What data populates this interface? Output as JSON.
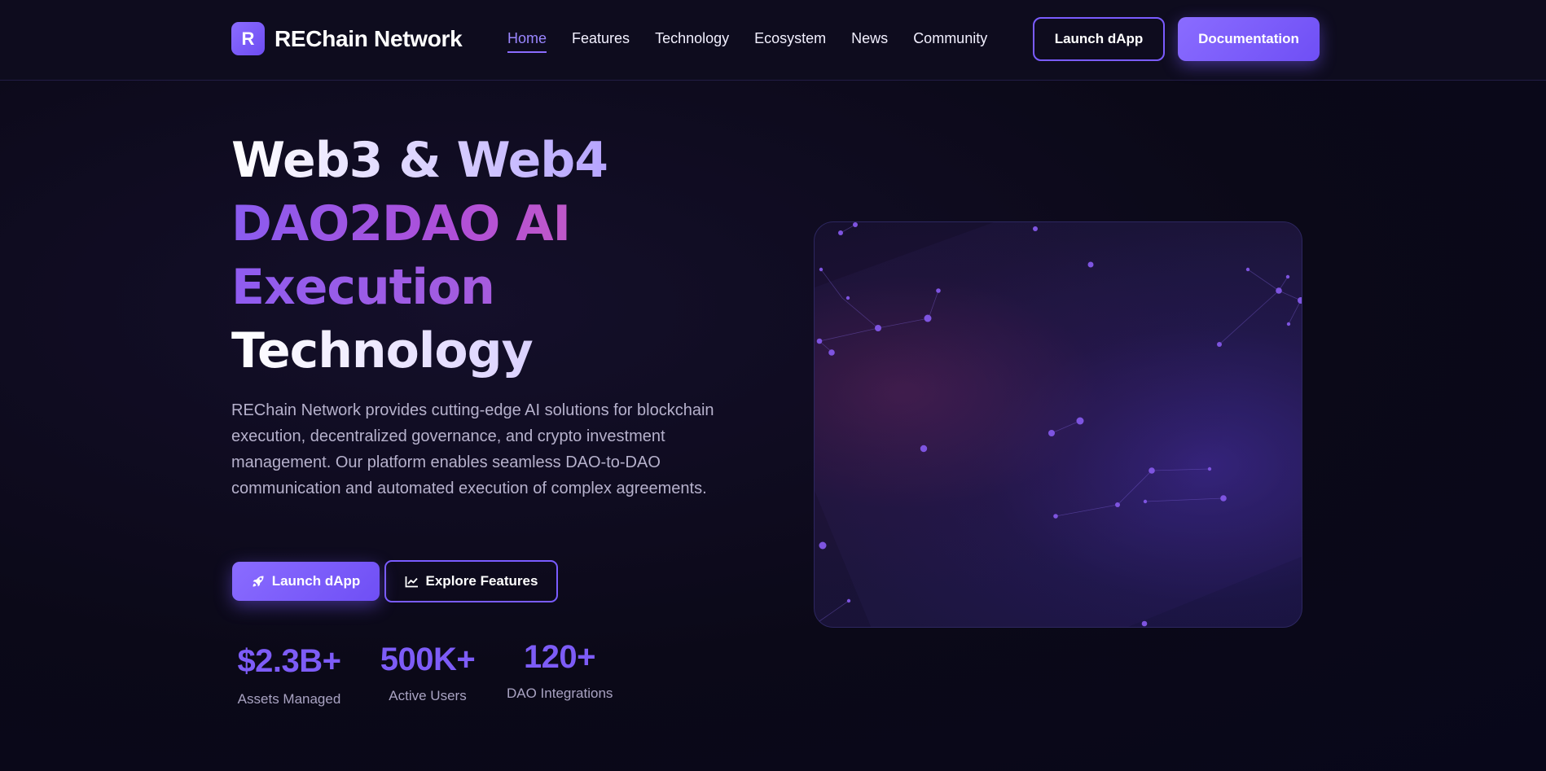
{
  "header": {
    "logo_letter": "R",
    "brand": "REChain Network",
    "nav": [
      {
        "label": "Home",
        "active": true
      },
      {
        "label": "Features",
        "active": false
      },
      {
        "label": "Technology",
        "active": false
      },
      {
        "label": "Ecosystem",
        "active": false
      },
      {
        "label": "News",
        "active": false
      },
      {
        "label": "Community",
        "active": false
      }
    ],
    "launch_label": "Launch dApp",
    "docs_label": "Documentation"
  },
  "hero": {
    "title_line1": "Web3 & Web4",
    "title_line2": "DAO2DAO AI",
    "title_line3": "Execution",
    "title_line4": "Technology",
    "description": "REChain Network provides cutting-edge AI solutions for blockchain execution, decentralized governance, and crypto investment management. Our platform enables seamless DAO-to-DAO communication and automated execution of complex agreements.",
    "primary_button": "Launch dApp",
    "primary_icon": "rocket-icon",
    "secondary_button": "Explore Features",
    "secondary_icon": "chart-line-icon"
  },
  "stats": [
    {
      "value": "$2.3B+",
      "label": "Assets Managed"
    },
    {
      "value": "500K+",
      "label": "Active Users"
    },
    {
      "value": "120+",
      "label": "DAO Integrations"
    }
  ],
  "colors": {
    "accent": "#7a5cff",
    "background": "#0b0918",
    "muted_text": "#b6b1cc"
  }
}
